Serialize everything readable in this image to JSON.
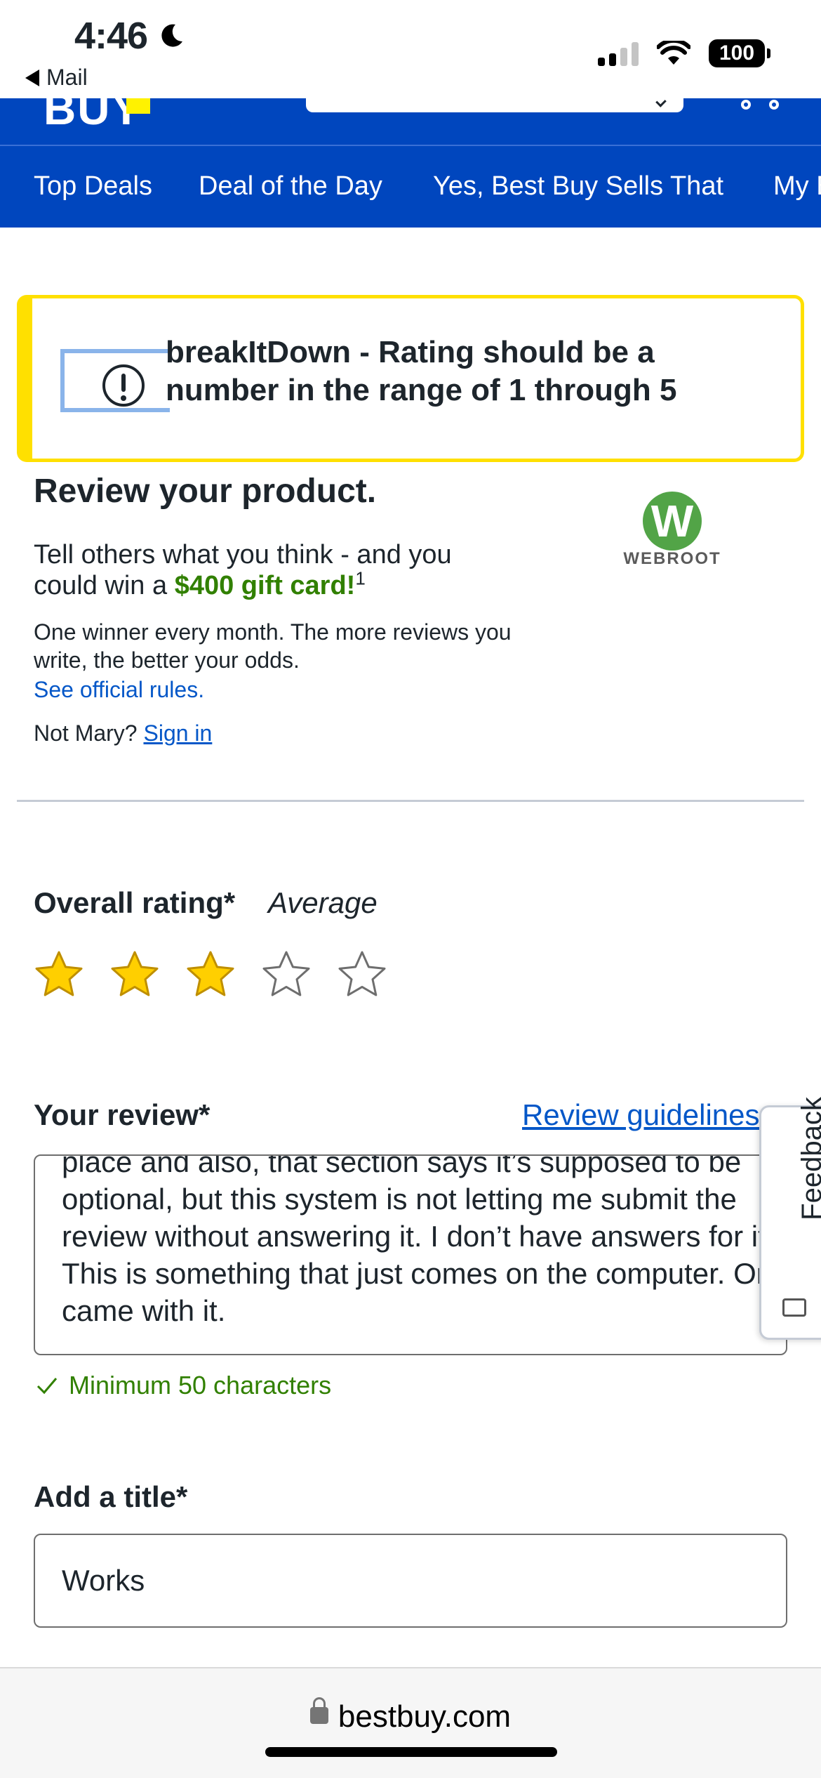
{
  "status_bar": {
    "time": "4:46",
    "back_app": "Mail",
    "battery": "100",
    "icons": [
      "moon-icon",
      "signal-icon",
      "wifi-icon",
      "battery-icon"
    ]
  },
  "nav": {
    "items": [
      "Top Deals",
      "Deal of the Day",
      "Yes, Best Buy Sells That",
      "My Best Buy"
    ]
  },
  "alert": {
    "message": "breakItDown - Rating should be a number in the range of 1 through 5",
    "icon": "exclamation-circle-icon"
  },
  "intro": {
    "heading": "Review your product.",
    "line1": "Tell others what you think - and you could win a",
    "gift": "$400 gift card!",
    "footnote": "1",
    "winner_text": "One winner every month. The more reviews you write, the better your odds.",
    "rules_link": "See official rules.",
    "not_user": "Not Mary?",
    "sign_in": "Sign in",
    "brand_logo_letter": "W",
    "brand_logo_word": "WEBROOT"
  },
  "rating": {
    "label": "Overall rating*",
    "description": "Average",
    "value": 3,
    "max": 5,
    "colors": {
      "filled": "#ffcf00",
      "filled_stroke": "#bf8f00",
      "empty_stroke": "#6e6e6e"
    }
  },
  "review": {
    "label": "Your review*",
    "guidelines_link": "Review guidelines",
    "text": "place and also, that section says it’s supposed to be optional, but this system is not letting me submit the review without answering it. I don’t have answers for it. This is something that just comes on the computer. Or came with it.",
    "min_note": "Minimum 50 characters",
    "feedback_tab": "Feedback"
  },
  "title_field": {
    "label": "Add a title*",
    "value": "Works"
  },
  "browser": {
    "url": "bestbuy.com"
  },
  "colors": {
    "brand_blue": "#0046be",
    "brand_yellow": "#fff200",
    "alert_yellow": "#ffe000",
    "link_blue": "#0457c8",
    "success_green": "#318000"
  }
}
